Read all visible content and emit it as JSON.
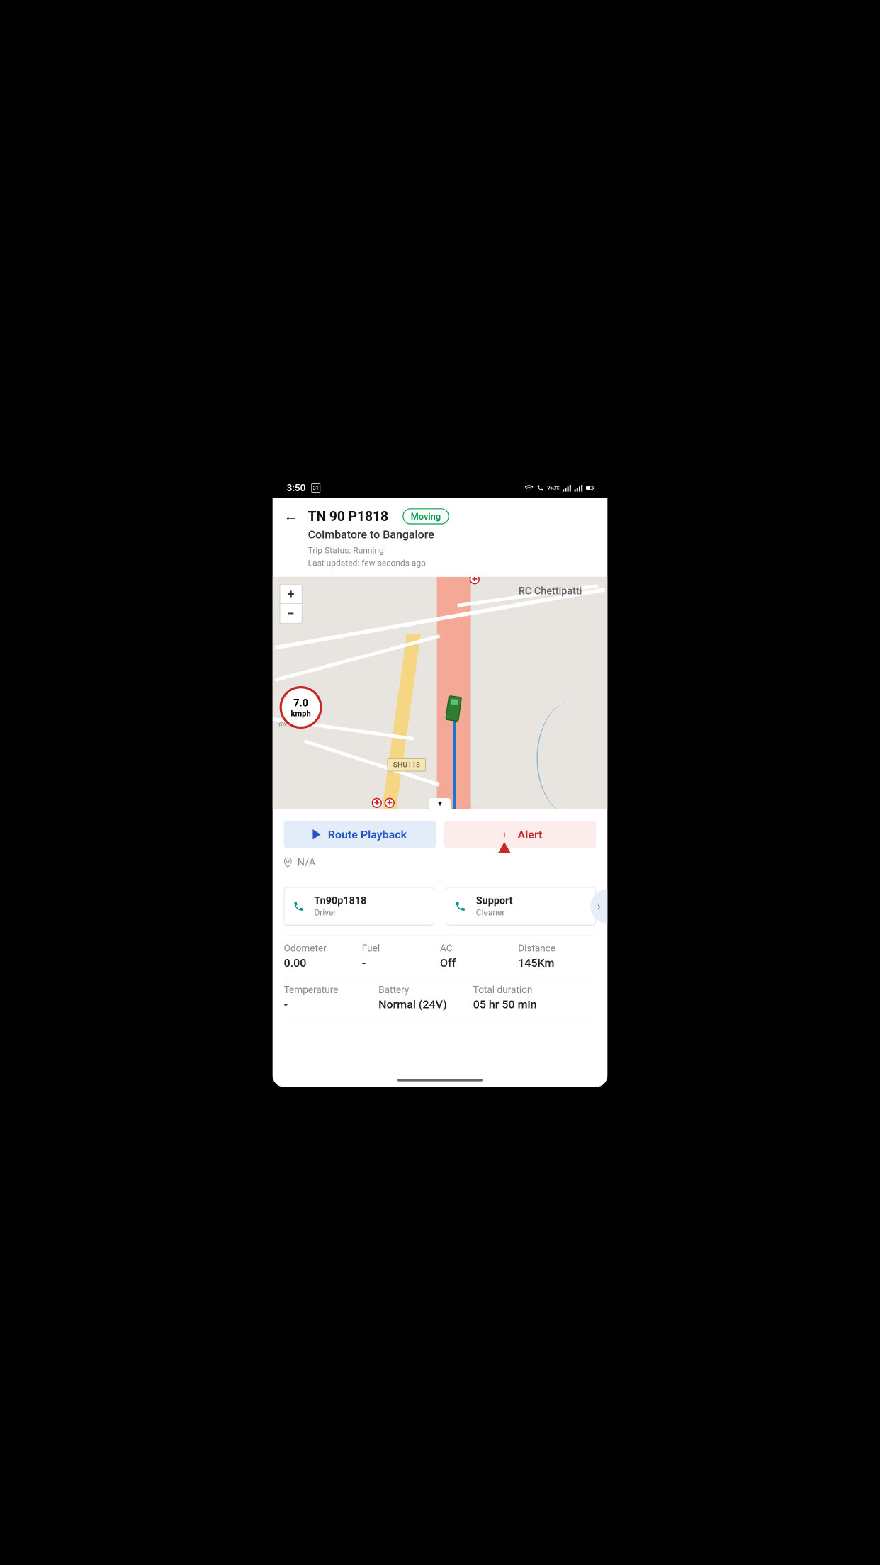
{
  "status_bar": {
    "time": "3:50",
    "calendar_day": "31"
  },
  "header": {
    "vehicle_id": "TN 90 P1818",
    "status_badge": "Moving",
    "route": "Coimbatore to Bangalore",
    "trip_status": "Trip Status: Running",
    "last_updated": "Last updated: few seconds ago"
  },
  "map": {
    "zoom_in": "+",
    "zoom_out": "−",
    "speed_value": "7.0",
    "speed_unit": "kmph",
    "place_label": "RC Chettipatti",
    "road_label": "mpaatti Rd",
    "route_badge": "SHU118",
    "collapse": "▼",
    "markers": [
      "✚",
      "✚",
      "✚"
    ]
  },
  "actions": {
    "playback": "Route Playback",
    "alert": "Alert"
  },
  "location": {
    "value": "N/A"
  },
  "contacts": [
    {
      "name": "Tn90p1818",
      "role": "Driver"
    },
    {
      "name": "Support",
      "role": "Cleaner"
    }
  ],
  "stats_row1": [
    {
      "label": "Odometer",
      "value": "0.00"
    },
    {
      "label": "Fuel",
      "value": "-"
    },
    {
      "label": "AC",
      "value": "Off"
    },
    {
      "label": "Distance",
      "value": "145Km"
    }
  ],
  "stats_row2": [
    {
      "label": "Temperature",
      "value": "-"
    },
    {
      "label": "Battery",
      "value": "Normal (24V)"
    },
    {
      "label": "Total duration",
      "value": "05 hr 50 min"
    }
  ],
  "arrow_right": "›"
}
